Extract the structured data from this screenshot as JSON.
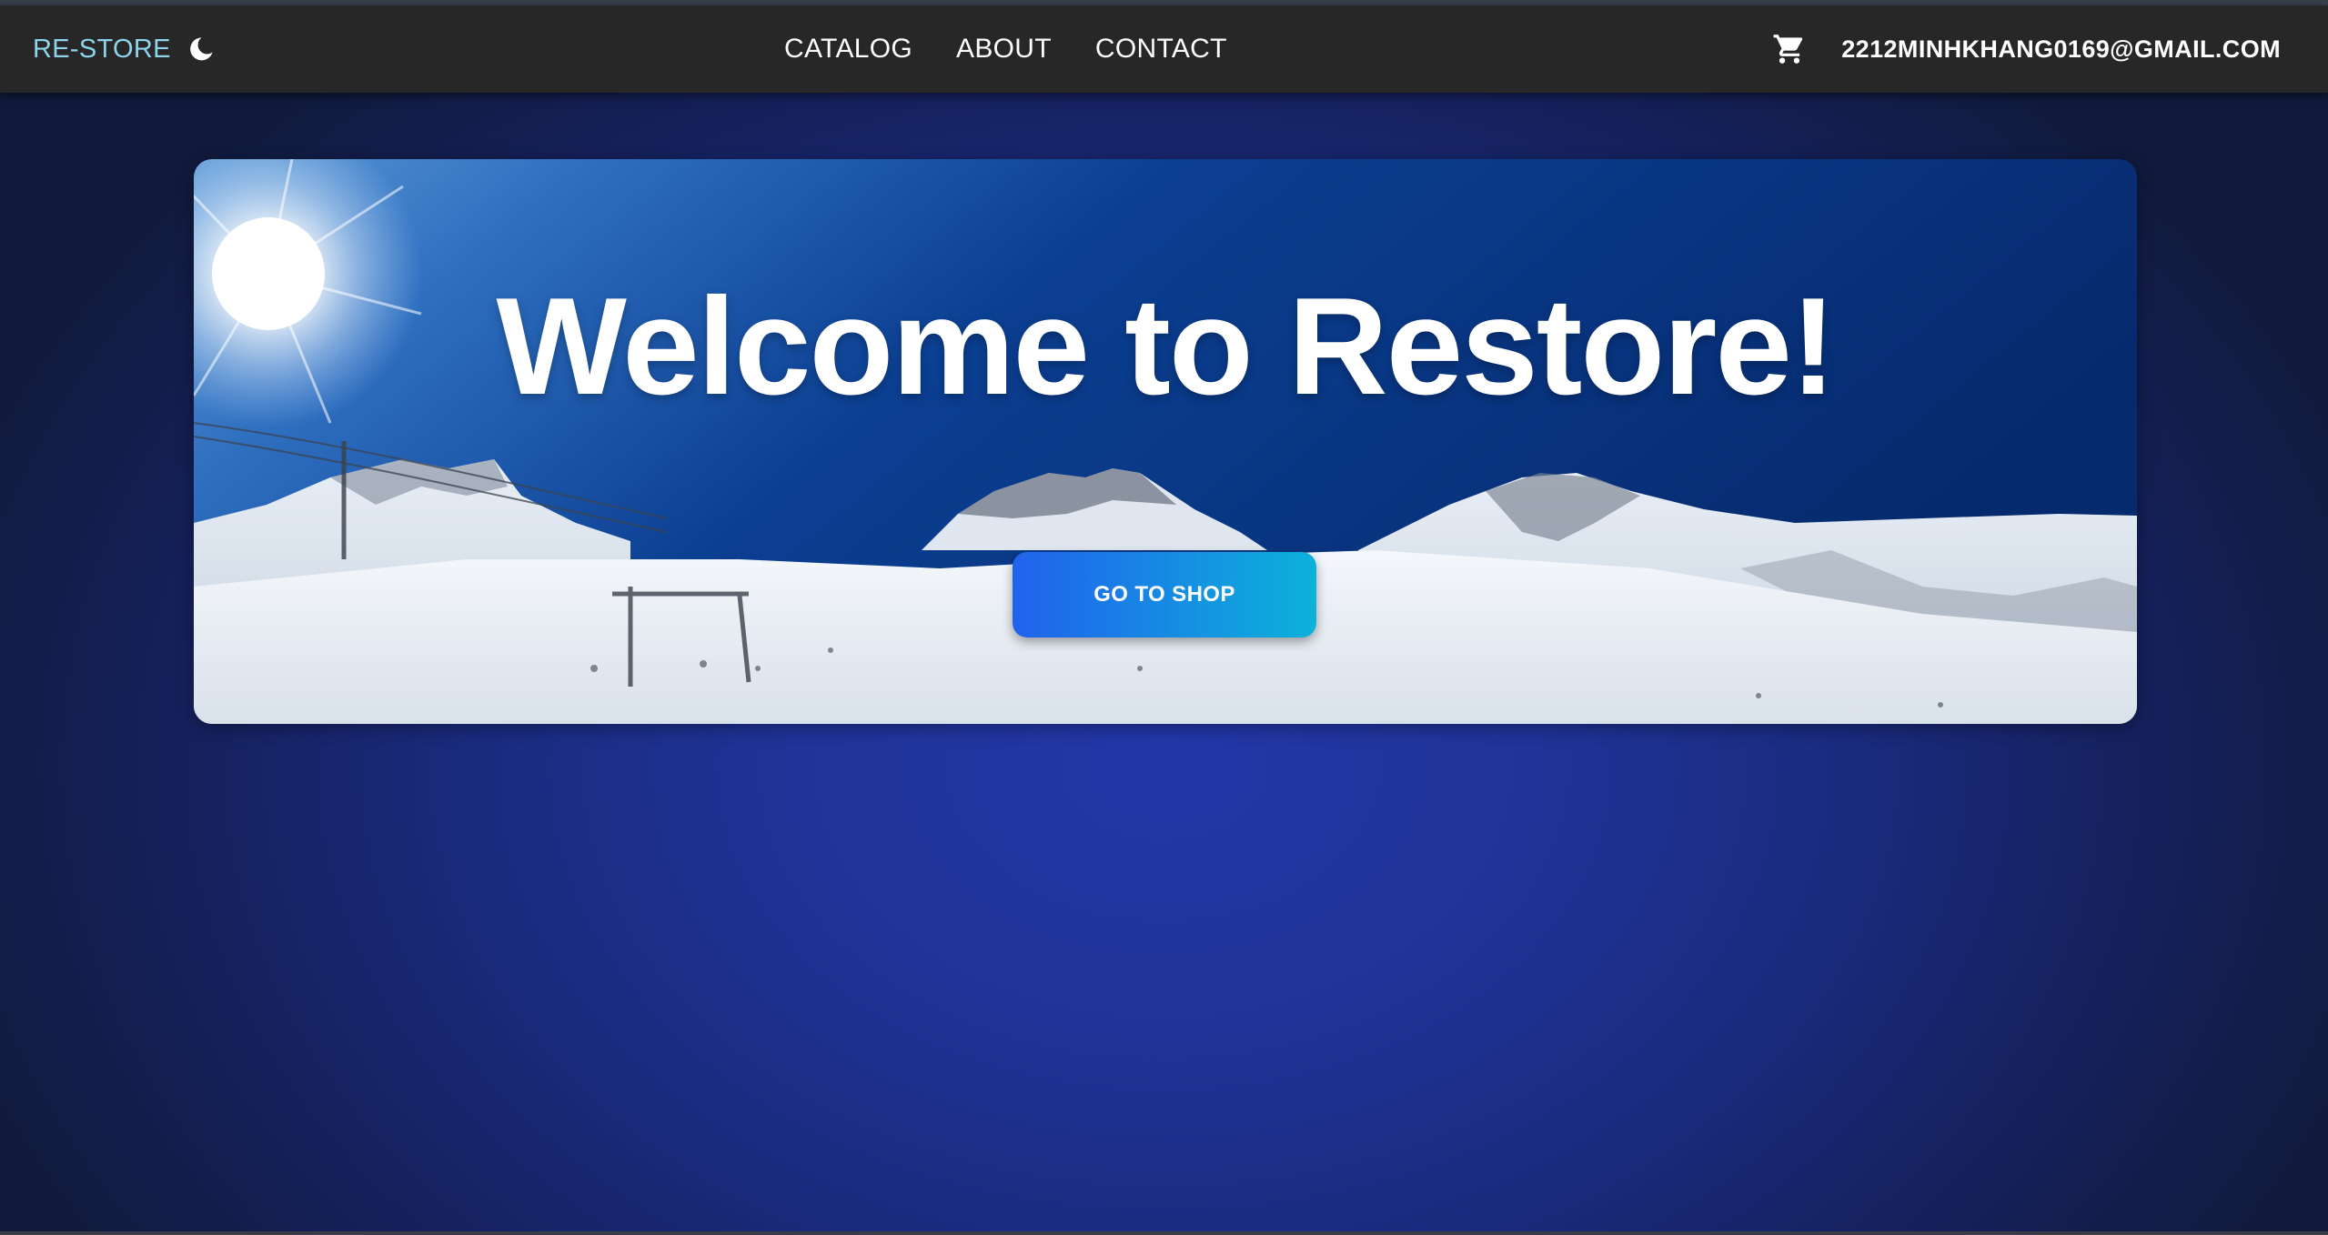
{
  "brand": {
    "name": "RE-STORE",
    "color": "#8ed4ec",
    "theme_toggle_icon": "moon-icon"
  },
  "nav": {
    "links": [
      {
        "label": "CATALOG"
      },
      {
        "label": "ABOUT"
      },
      {
        "label": "CONTACT"
      }
    ]
  },
  "user": {
    "cart_icon": "cart-icon",
    "email": "2212MINHKHANG0169@GMAIL.COM"
  },
  "hero": {
    "title": "Welcome to Restore!",
    "button_label": "GO TO SHOP",
    "button_gradient": [
      "#2162ec",
      "#0cb2da"
    ],
    "background": "snowy mountain ski slope image"
  },
  "colors": {
    "appbar": "#272727",
    "page_background": "#1f3397"
  }
}
